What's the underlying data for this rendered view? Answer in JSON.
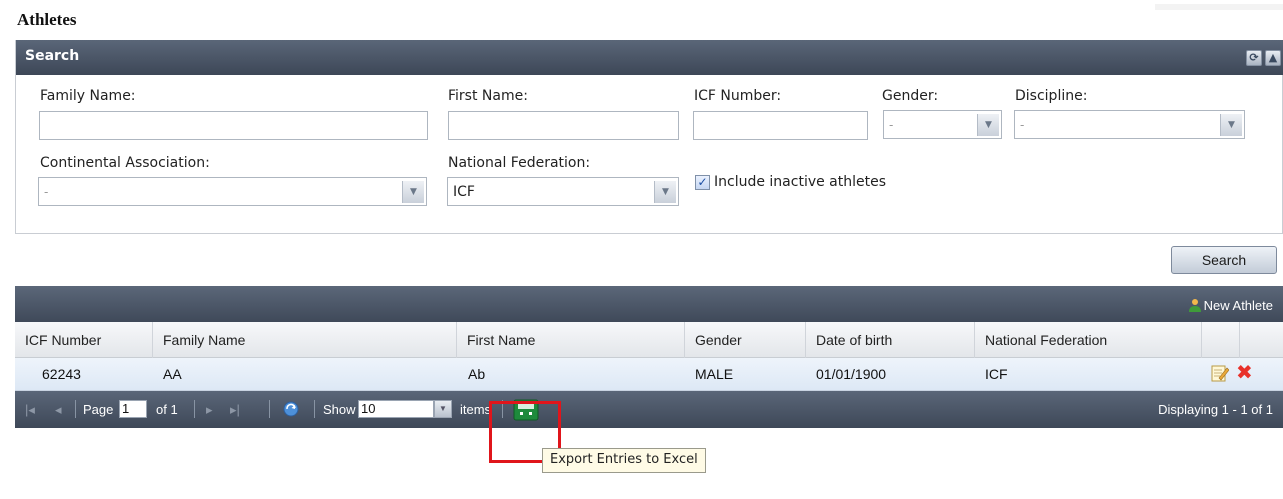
{
  "page": {
    "title": "Athletes"
  },
  "search_panel": {
    "title": "Search",
    "fields": {
      "family_name": {
        "label": "Family Name:",
        "value": ""
      },
      "first_name": {
        "label": "First Name:",
        "value": ""
      },
      "icf_number": {
        "label": "ICF Number:",
        "value": ""
      },
      "gender": {
        "label": "Gender:",
        "value": "-"
      },
      "discipline": {
        "label": "Discipline:",
        "value": "-"
      },
      "continental_association": {
        "label": "Continental Association:",
        "value": "-"
      },
      "national_federation": {
        "label": "National Federation:",
        "value": "ICF"
      },
      "include_inactive": {
        "label": "Include inactive athletes",
        "checked": true
      }
    },
    "search_button": "Search"
  },
  "grid": {
    "new_athlete_label": "New Athlete",
    "columns": [
      "ICF Number",
      "Family Name",
      "First Name",
      "Gender",
      "Date of birth",
      "National Federation"
    ],
    "rows": [
      {
        "icf_number": "62243",
        "family_name": "AA",
        "first_name": "Ab",
        "gender": "MALE",
        "date_of_birth": "01/01/1900",
        "national_federation": "ICF"
      }
    ]
  },
  "pager": {
    "page_label": "Page",
    "page_value": "1",
    "of_label": "of 1",
    "show_label": "Show",
    "show_value": "10",
    "items_label": "items",
    "displaying": "Displaying 1 - 1 of 1"
  },
  "tooltip": {
    "text": "Export Entries to Excel"
  },
  "colors": {
    "header_dark": "#3d4757",
    "row_bg": "#dde8f5",
    "highlight": "#e0151b",
    "delete_red": "#e8312a"
  }
}
